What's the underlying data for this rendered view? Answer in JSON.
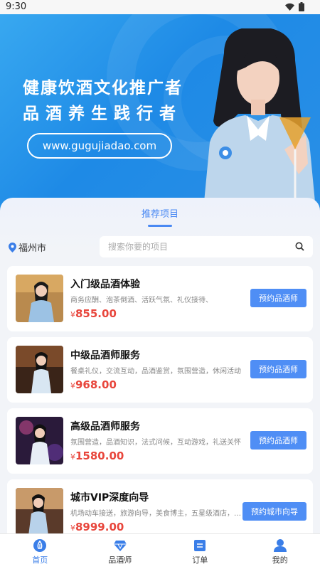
{
  "status_bar": {
    "time": "9:30"
  },
  "banner": {
    "title_line1": "健康饮酒文化推广者",
    "title_line2": "品酒养生践行者",
    "url": "www.gugujiadao.com"
  },
  "section_tab": "推荐项目",
  "location": "福州市",
  "search": {
    "placeholder": "搜索你要的项目",
    "value": ""
  },
  "currency_symbol": "¥",
  "items": [
    {
      "title": "入门级品酒体验",
      "desc": "商务应酬、泡茶倒酒、活跃气氛、礼仪接待、",
      "price": "855.00",
      "button": "预约品酒师"
    },
    {
      "title": "中级品酒师服务",
      "desc": "餐桌礼仪，交流互动，品酒鉴赏，氛围营造，休闲活动",
      "price": "968.00",
      "button": "预约品酒师"
    },
    {
      "title": "高级品酒师服务",
      "desc": "氛围营造，品酒知识，法式问候，互动游戏，礼送关怀",
      "price": "1580.00",
      "button": "预约品酒师"
    },
    {
      "title": "城市VIP深度向导",
      "desc": "机场动车接送，旅游向导，美食博主，五星级酒店，…",
      "price": "8999.00",
      "button": "预约城市向导"
    }
  ],
  "tabbar": [
    {
      "label": "首页",
      "icon": "home-icon",
      "active": true
    },
    {
      "label": "品酒师",
      "icon": "diamond-icon",
      "active": false
    },
    {
      "label": "订单",
      "icon": "order-icon",
      "active": false
    },
    {
      "label": "我的",
      "icon": "profile-icon",
      "active": false
    }
  ],
  "colors": {
    "accent": "#4a89f3",
    "price": "#e8463c",
    "banner": "#2a8fe6"
  }
}
